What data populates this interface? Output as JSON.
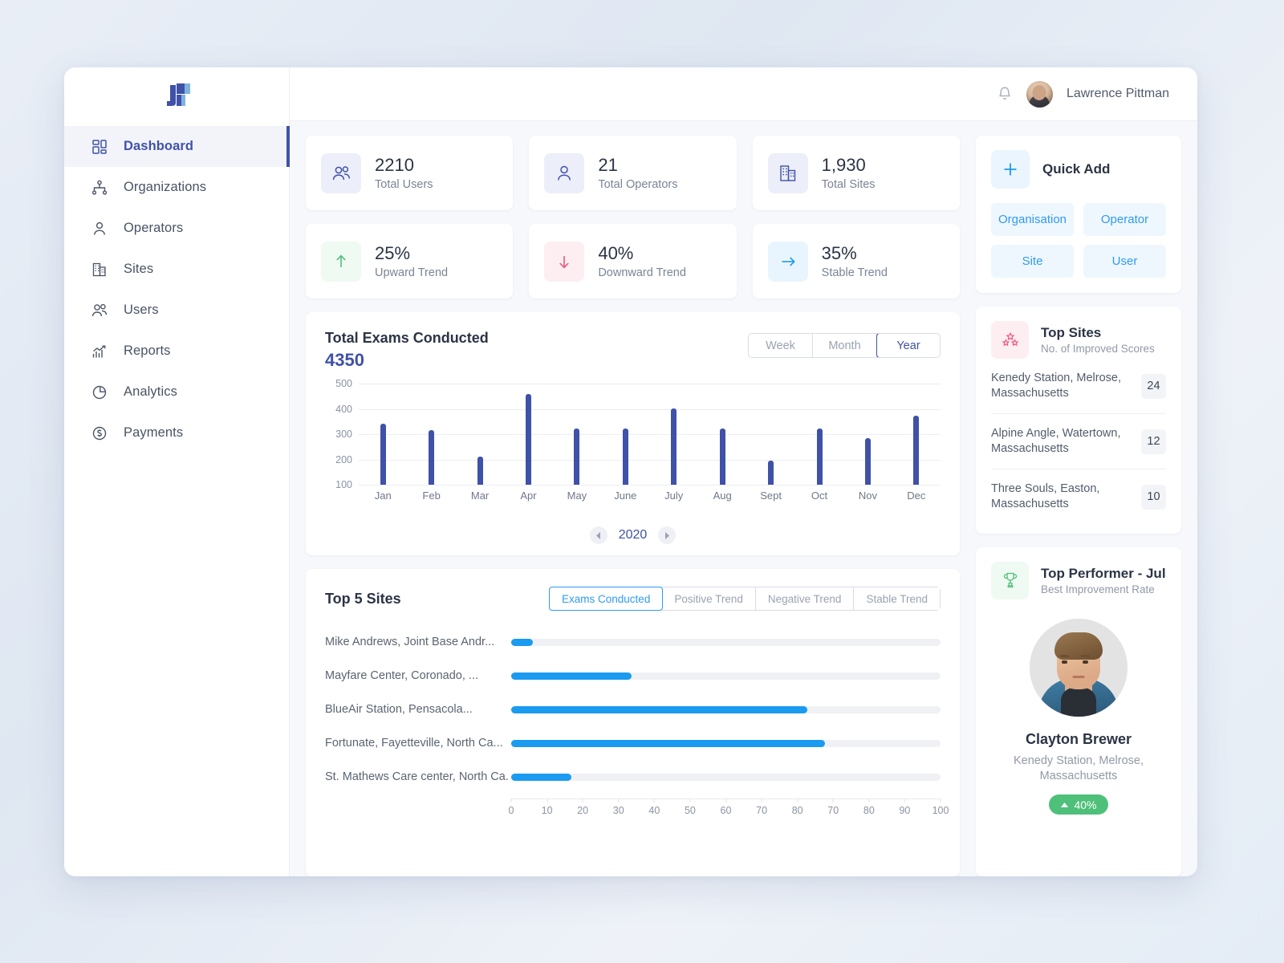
{
  "brand": {
    "logo_icon": "brand-logo-icon"
  },
  "sidebar": {
    "items": [
      {
        "label": "Dashboard",
        "icon": "dashboard-grid-icon",
        "active": true
      },
      {
        "label": "Organizations",
        "icon": "org-tree-icon",
        "active": false
      },
      {
        "label": "Operators",
        "icon": "user-icon",
        "active": false
      },
      {
        "label": "Sites",
        "icon": "building-icon",
        "active": false
      },
      {
        "label": "Users",
        "icon": "users-icon",
        "active": false
      },
      {
        "label": "Reports",
        "icon": "chart-bar-icon",
        "active": false
      },
      {
        "label": "Analytics",
        "icon": "pie-chart-icon",
        "active": false
      },
      {
        "label": "Payments",
        "icon": "dollar-circle-icon",
        "active": false
      }
    ]
  },
  "topbar": {
    "notification_icon": "bell-icon",
    "user_name": "Lawrence Pittman",
    "avatar_icon": "avatar"
  },
  "stats": [
    {
      "value": "2210",
      "label": "Total Users",
      "icon": "users-icon",
      "icon_bg": "#eceefa",
      "icon_color": "#3f51a8"
    },
    {
      "value": "21",
      "label": "Total Operators",
      "icon": "user-icon",
      "icon_bg": "#eceefa",
      "icon_color": "#3f51a8"
    },
    {
      "value": "1,930",
      "label": "Total Sites",
      "icon": "building-icon",
      "icon_bg": "#eceefa",
      "icon_color": "#3f51a8"
    }
  ],
  "trends": [
    {
      "value": "25%",
      "label": "Upward Trend",
      "icon": "arrow-up-icon",
      "icon_bg": "#effaf2",
      "icon_color": "#4fc07a"
    },
    {
      "value": "40%",
      "label": "Downward Trend",
      "icon": "arrow-down-icon",
      "icon_bg": "#fdeef2",
      "icon_color": "#f0557c"
    },
    {
      "value": "35%",
      "label": "Stable Trend",
      "icon": "arrow-right-icon",
      "icon_bg": "#e9f5fe",
      "icon_color": "#1a9bf0"
    }
  ],
  "quick_add": {
    "title": "Quick Add",
    "plus_icon": "plus-icon",
    "buttons": [
      "Organisation",
      "Operator",
      "Site",
      "User"
    ]
  },
  "exams": {
    "title": "Total Exams Conducted",
    "total": "4350",
    "ranges": [
      {
        "label": "Week",
        "active": false
      },
      {
        "label": "Month",
        "active": false
      },
      {
        "label": "Year",
        "active": true
      }
    ],
    "year": "2020",
    "prev_icon": "chevron-left-icon",
    "next_icon": "chevron-right-icon"
  },
  "top_sites": {
    "title": "Top Sites",
    "subtitle": "No. of Improved Scores",
    "icon": "stars-icon",
    "rows": [
      {
        "name": "Kenedy Station, Melrose, Massachusetts",
        "count": "24"
      },
      {
        "name": "Alpine Angle, Watertown, Massachusetts",
        "count": "12"
      },
      {
        "name": "Three Souls, Easton, Massachusetts",
        "count": "10"
      }
    ]
  },
  "top5": {
    "title": "Top 5 Sites",
    "tabs": [
      {
        "label": "Exams Conducted",
        "active": true
      },
      {
        "label": "Positive Trend",
        "active": false
      },
      {
        "label": "Negative Trend",
        "active": false
      },
      {
        "label": "Stable Trend",
        "active": false
      }
    ]
  },
  "top_performer": {
    "title": "Top Performer - Jul",
    "subtitle": "Best Improvement Rate",
    "icon": "trophy-icon",
    "name": "Clayton Brewer",
    "site": "Kenedy Station, Melrose, Massachusetts",
    "badge_value": "40%",
    "badge_icon": "caret-up-icon",
    "badge_color": "#4fc07a"
  },
  "chart_data": [
    {
      "type": "bar",
      "title": "Total Exams Conducted",
      "categories": [
        "Jan",
        "Feb",
        "Mar",
        "Apr",
        "May",
        "June",
        "July",
        "Aug",
        "Sept",
        "Oct",
        "Nov",
        "Dec"
      ],
      "values": [
        340,
        315,
        210,
        458,
        322,
        322,
        403,
        322,
        196,
        322,
        283,
        373
      ],
      "ytick_labels": [
        "500",
        "400",
        "300",
        "200",
        "100"
      ],
      "yticks": [
        500,
        400,
        300,
        200,
        100
      ],
      "ylim": [
        100,
        500
      ],
      "xlabel": "",
      "ylabel": "",
      "grid": true,
      "legend": "none",
      "bar_color": "#3f51a8",
      "annotation": "2020"
    },
    {
      "type": "bar",
      "orientation": "horizontal",
      "title": "Top 5 Sites",
      "categories": [
        "Mike Andrews, Joint Base Andr...",
        "Mayfare Center, Coronado, ...",
        "BlueAir Station, Pensacola...",
        "Fortunate, Fayetteville, North Ca...",
        "St. Mathews Care center, North Ca."
      ],
      "values": [
        5,
        28,
        69,
        73,
        14
      ],
      "xtick_labels": [
        "0",
        "10",
        "20",
        "30",
        "40",
        "50",
        "60",
        "70",
        "80",
        "70",
        "80",
        "90",
        "100"
      ],
      "xlim": [
        0,
        100
      ],
      "ylabel": "",
      "xlabel": "",
      "grid": false,
      "legend": "none",
      "bar_color": "#1a9bf0",
      "track_color": "#f0f1f4"
    }
  ]
}
